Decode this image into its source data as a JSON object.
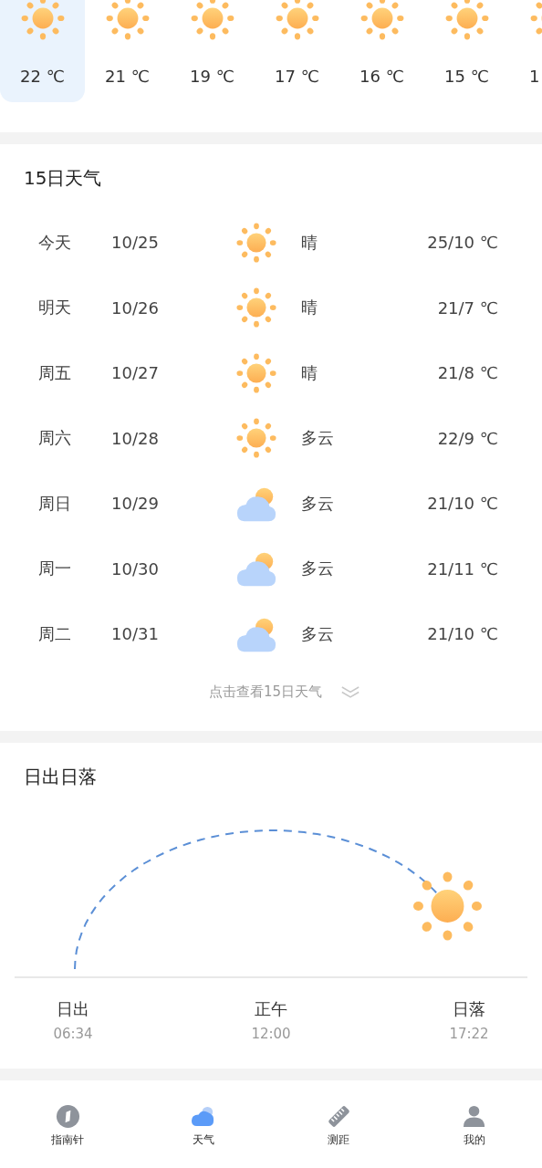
{
  "hourly": [
    {
      "temp": "22 ℃",
      "kind": "sun",
      "selected": true
    },
    {
      "temp": "21 ℃",
      "kind": "sun",
      "selected": false
    },
    {
      "temp": "19 ℃",
      "kind": "sun",
      "selected": false
    },
    {
      "temp": "17 ℃",
      "kind": "sun",
      "selected": false
    },
    {
      "temp": "16 ℃",
      "kind": "sun",
      "selected": false
    },
    {
      "temp": "15 ℃",
      "kind": "sun",
      "selected": false
    },
    {
      "temp": "1",
      "kind": "sun",
      "selected": false
    }
  ],
  "forecast": {
    "title": "15日天气",
    "days": [
      {
        "day": "今天",
        "date": "10/25",
        "kind": "sun",
        "condition": "晴",
        "temps": "25/10 ℃"
      },
      {
        "day": "明天",
        "date": "10/26",
        "kind": "sun",
        "condition": "晴",
        "temps": "21/7 ℃"
      },
      {
        "day": "周五",
        "date": "10/27",
        "kind": "sun",
        "condition": "晴",
        "temps": "21/8 ℃"
      },
      {
        "day": "周六",
        "date": "10/28",
        "kind": "sun",
        "condition": "多云",
        "temps": "22/9 ℃"
      },
      {
        "day": "周日",
        "date": "10/29",
        "kind": "cloud",
        "condition": "多云",
        "temps": "21/10 ℃"
      },
      {
        "day": "周一",
        "date": "10/30",
        "kind": "cloud",
        "condition": "多云",
        "temps": "21/11 ℃"
      },
      {
        "day": "周二",
        "date": "10/31",
        "kind": "cloud",
        "condition": "多云",
        "temps": "21/10 ℃"
      }
    ],
    "more_link": "点击查看15日天气"
  },
  "sun": {
    "title": "日出日落",
    "level": 0.85,
    "points": [
      {
        "label": "日出",
        "time": "06:34"
      },
      {
        "label": "正午",
        "time": "12:00"
      },
      {
        "label": "日落",
        "time": "17:22"
      }
    ]
  },
  "nav": [
    {
      "label": "指南针",
      "kind": "compass",
      "selected": false
    },
    {
      "label": "天气",
      "kind": "cloud",
      "selected": true
    },
    {
      "label": "测距",
      "kind": "ruler",
      "selected": false
    },
    {
      "label": "我的",
      "kind": "person",
      "selected": false
    }
  ]
}
